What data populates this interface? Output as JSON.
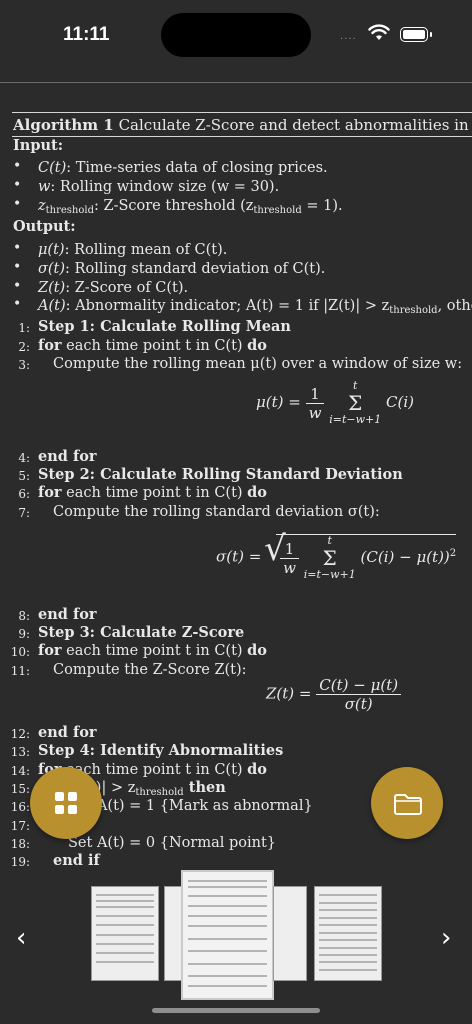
{
  "status": {
    "time": "11:11",
    "signal_text": "....",
    "icons": [
      "wifi-icon",
      "battery-icon"
    ]
  },
  "algorithm": {
    "title_label": "Algorithm 1",
    "title_text": "Calculate Z-Score and detect abnormalities in cryptocurrency",
    "input_label": "Input:",
    "inputs": [
      {
        "sym": "C(t)",
        "text": ": Time-series data of closing prices."
      },
      {
        "sym": "w",
        "text": ": Rolling window size (w = 30)."
      },
      {
        "sym": "z",
        "sub": "threshold",
        "text": ": Z-Score threshold (z",
        "sub2": "threshold",
        "tail": " = 1)."
      }
    ],
    "output_label": "Output:",
    "outputs": [
      {
        "sym": "μ(t)",
        "text": ": Rolling mean of C(t)."
      },
      {
        "sym": "σ(t)",
        "text": ": Rolling standard deviation of C(t)."
      },
      {
        "sym": "Z(t)",
        "text": ": Z-Score of C(t)."
      },
      {
        "sym": "A(t)",
        "text": ": Abnormality indicator; A(t) = 1 if |Z(t)| > z",
        "sub": "threshold",
        "tail": ", otherwise"
      }
    ],
    "steps": [
      {
        "n": "1:",
        "bold": "Step 1: Calculate Rolling Mean",
        "text": ""
      },
      {
        "n": "2:",
        "bold": "for",
        "text": " each time point t in C(t) ",
        "bold2": "do"
      },
      {
        "n": "3:",
        "text": "Compute the rolling mean μ(t) over a window of size w:"
      },
      {
        "n": "4:",
        "bold": "end for"
      },
      {
        "n": "5:",
        "bold": "Step 2: Calculate Rolling Standard Deviation"
      },
      {
        "n": "6:",
        "bold": "for",
        "text": " each time point t in C(t) ",
        "bold2": "do"
      },
      {
        "n": "7:",
        "text": "Compute the rolling standard deviation σ(t):"
      },
      {
        "n": "8:",
        "bold": "end for"
      },
      {
        "n": "9:",
        "bold": "Step 3: Calculate Z-Score"
      },
      {
        "n": "10:",
        "bold": "for",
        "text": " each time point t in C(t) ",
        "bold2": "do"
      },
      {
        "n": "11:",
        "text": "Compute the Z-Score Z(t):"
      },
      {
        "n": "12:",
        "bold": "end for"
      },
      {
        "n": "13:",
        "bold": "Step 4: Identify Abnormalities"
      },
      {
        "n": "14:",
        "bold": "for",
        "text": " each time point t in C(t) ",
        "bold2": "do"
      },
      {
        "n": "15:",
        "bold": "if",
        "text": " |Z(t)| > z",
        "sub": "threshold",
        "bold2": " then"
      },
      {
        "n": "16:",
        "text": "Set A(t) = 1 {Mark as abnormal}"
      },
      {
        "n": "17:",
        "bold": "else"
      },
      {
        "n": "18:",
        "text": "Set A(t) = 0 {Normal point}"
      },
      {
        "n": "19:",
        "bold": "end if"
      }
    ],
    "eq1": {
      "lhs": "μ(t) =",
      "num": "1",
      "den": "w",
      "sum_top": "t",
      "sum_bot": "i=t−w+1",
      "body": "C(i)"
    },
    "eq2": {
      "lhs": "σ(t) =",
      "num": "1",
      "den": "w",
      "sum_top": "t",
      "sum_bot": "i=t−w+1",
      "body": "(C(i) − μ(t))",
      "sup": "2"
    },
    "eq3": {
      "lhs": "Z(t) =",
      "num": "C(t) − μ(t)",
      "den": "σ(t)"
    }
  },
  "fab": {
    "left_icon": "grid-icon",
    "right_icon": "folder-icon"
  },
  "thumbnails": {
    "count": 5,
    "active_index": 2
  },
  "nav": {
    "prev": "‹",
    "next": "›"
  }
}
